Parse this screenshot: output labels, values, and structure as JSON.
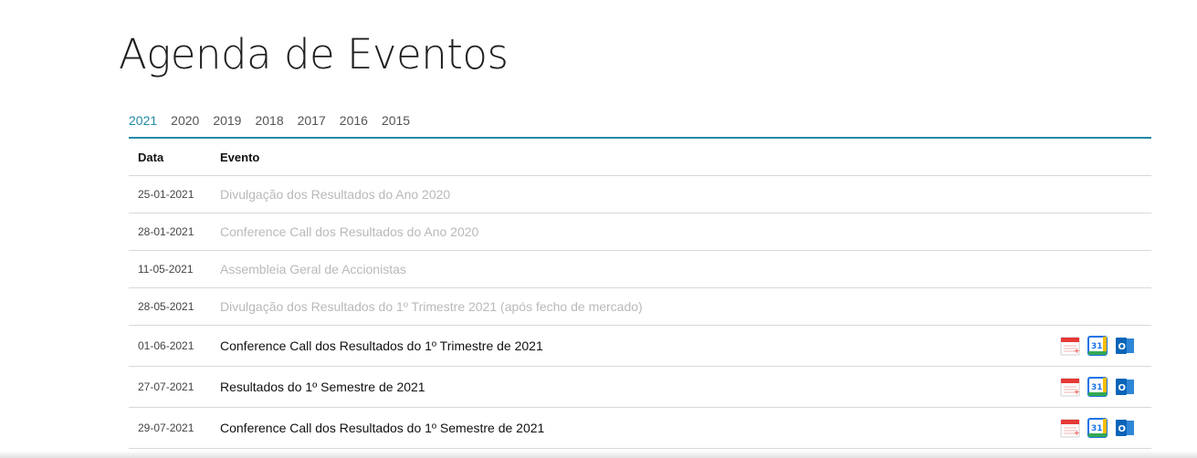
{
  "page": {
    "title": "Agenda de Eventos"
  },
  "years": [
    "2021",
    "2020",
    "2019",
    "2018",
    "2017",
    "2016",
    "2015"
  ],
  "active_year": "2021",
  "table": {
    "headers": {
      "date": "Data",
      "event": "Evento"
    },
    "rows": [
      {
        "date": "25-01-2021",
        "event": "Divulgação dos Resultados do Ano 2020",
        "status": "past"
      },
      {
        "date": "28-01-2021",
        "event": "Conference Call dos Resultados do Ano 2020",
        "status": "past"
      },
      {
        "date": "11-05-2021",
        "event": "Assembleia Geral de Accionistas",
        "status": "past"
      },
      {
        "date": "28-05-2021",
        "event": "Divulgação dos Resultados do 1º Trimestre 2021 (após fecho de mercado)",
        "status": "past"
      },
      {
        "date": "01-06-2021",
        "event": "Conference Call dos Resultados do 1º Trimestre de 2021",
        "status": "future"
      },
      {
        "date": "27-07-2021",
        "event": "Resultados do 1º Semestre de 2021",
        "status": "future"
      },
      {
        "date": "29-07-2021",
        "event": "Conference Call dos Resultados do 1º Semestre de 2021",
        "status": "future"
      }
    ]
  },
  "calendar_icons": {
    "ical": {
      "icon": "ical-calendar-icon",
      "color": "#e53935"
    },
    "google": {
      "icon": "google-calendar-icon",
      "label": "31",
      "color": "#1a73e8"
    },
    "outlook": {
      "icon": "outlook-calendar-icon",
      "label": "O",
      "color": "#0a64b8"
    }
  },
  "colors": {
    "accent": "#1f8aa6",
    "past_text": "#b9b9b9"
  }
}
